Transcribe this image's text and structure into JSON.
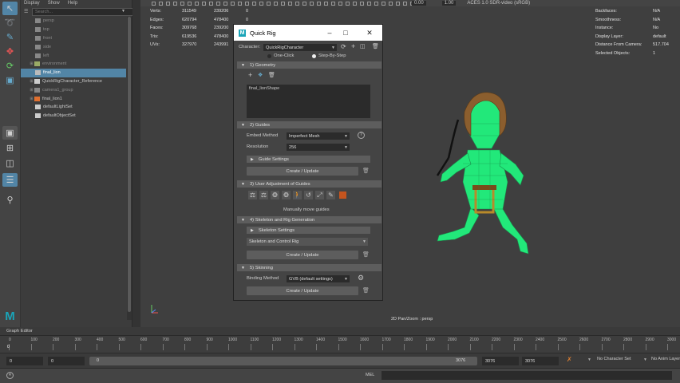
{
  "outliner": {
    "menu": [
      "Display",
      "Show",
      "Help"
    ],
    "search_placeholder": "Search...",
    "items": [
      {
        "label": "persp",
        "dim": true
      },
      {
        "label": "top",
        "dim": true
      },
      {
        "label": "front",
        "dim": true
      },
      {
        "label": "side",
        "dim": true
      },
      {
        "label": "left",
        "dim": true
      },
      {
        "label": "environment",
        "dim": true
      },
      {
        "label": "final_lion",
        "dim": false
      },
      {
        "label": "QuickRigCharacter_Reference",
        "dim": false
      },
      {
        "label": "camera1_group",
        "dim": true
      },
      {
        "label": "final_lion1",
        "dim": false
      },
      {
        "label": "defaultLightSet",
        "dim": false
      },
      {
        "label": "defaultObjectSet",
        "dim": false
      }
    ]
  },
  "viewport": {
    "toolbar_values": {
      "exposure": "0.00",
      "gamma": "1.00",
      "color_space": "ACES 1.0 SDR-video (sRGB)"
    },
    "hud_left": [
      {
        "label": "Verts:",
        "a": "311549",
        "b": "239206",
        "c": "0"
      },
      {
        "label": "Edges:",
        "a": "620794",
        "b": "478400",
        "c": "0"
      },
      {
        "label": "Faces:",
        "a": "309768",
        "b": "239200",
        "c": "0"
      },
      {
        "label": "Tris:",
        "a": "619536",
        "b": "478400",
        "c": "0"
      },
      {
        "label": "UVs:",
        "a": "327970",
        "b": "243991",
        "c": "0"
      }
    ],
    "hud_right": [
      {
        "label": "Backfaces:",
        "value": "N/A"
      },
      {
        "label": "Smoothness:",
        "value": "N/A"
      },
      {
        "label": "Instance:",
        "value": "No"
      },
      {
        "label": "Display Layer:",
        "value": "default"
      },
      {
        "label": "Distance From Camera:",
        "value": "517.704"
      },
      {
        "label": "Selected Objects:",
        "value": "1"
      }
    ],
    "camera_label": "2D Pan/Zoom : persp"
  },
  "quickrig": {
    "title": "Quick Rig",
    "character_label": "Character:",
    "character_value": "QuickRigCharacter",
    "mode_one_click": "One-Click",
    "mode_step": "Step-By-Step",
    "sec_geometry": "1) Geometry",
    "geometry_item": "final_lionShape",
    "sec_guides": "2) Guides",
    "embed_label": "Embed Method",
    "embed_value": "Imperfect Mesh",
    "resolution_label": "Resolution",
    "resolution_value": "256",
    "guide_settings": "Guide Settings",
    "create_update": "Create / Update",
    "sec_user_adjust": "3) User Adjustment of Guides",
    "manually_move": "Manually move guides",
    "sec_skeleton": "4) Skeleton and Rig Generation",
    "skeleton_settings": "Skeleton Settings",
    "skeleton_value": "Skeleton and Control Rig",
    "sec_skinning": "5) Skinning",
    "binding_label": "Binding Method",
    "binding_value": "GVB (default settings)"
  },
  "bottom": {
    "graph_editor": "Graph Editor",
    "ticks": [
      "0",
      "100",
      "200",
      "300",
      "400",
      "500",
      "600",
      "700",
      "800",
      "900",
      "1000",
      "1100",
      "1200",
      "1300",
      "1400",
      "1500",
      "1600",
      "1700",
      "1800",
      "1900",
      "2000",
      "2100",
      "2200",
      "2300",
      "2400",
      "2500",
      "2600",
      "2700",
      "2800",
      "2900",
      "3000"
    ],
    "start_field": "0",
    "start_field2": "0",
    "range_slider_start": "0",
    "range_slider_end": "3076",
    "end_field": "3076",
    "end_field2": "3076",
    "character_set": "No Character Set",
    "anim_layer": "No Anim Layer",
    "current_frame": "0",
    "mel_label": "MEL"
  },
  "colors": {
    "accent": "#5285a6",
    "mesh": "#22e87a",
    "maya_logo": "#1aa4b8"
  }
}
